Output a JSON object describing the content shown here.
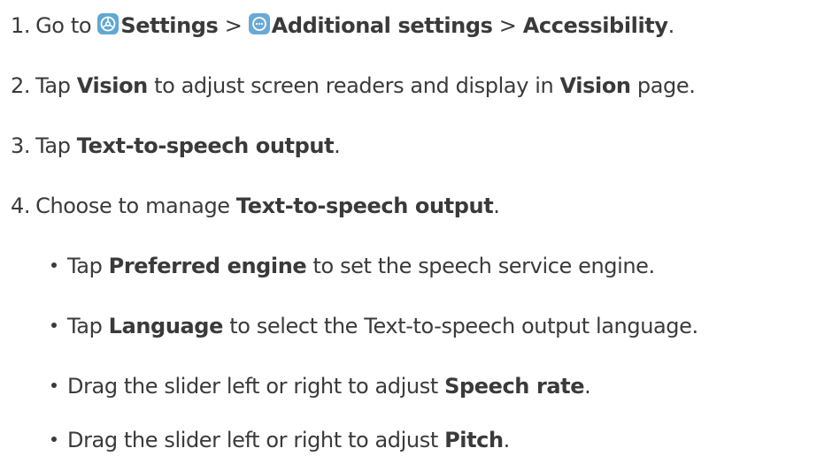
{
  "steps": [
    {
      "number": "1.",
      "go_to": "Go to",
      "settings": "Settings",
      "sep1": ">",
      "additional": "Additional settings",
      "sep2": ">",
      "accessibility": "Accessibility",
      "end": "."
    },
    {
      "number": "2.",
      "pre": "Tap",
      "vision": "Vision",
      "mid": "to adjust screen readers and display in",
      "vision_page": "Vision",
      "post": "page."
    },
    {
      "number": "3.",
      "pre": "Tap",
      "target": "Text-to-speech output",
      "end": "."
    },
    {
      "number": "4.",
      "pre": "Choose to manage",
      "target": "Text-to-speech output",
      "end": "."
    }
  ],
  "bullets": [
    {
      "pre": "Tap",
      "target": "Preferred engine",
      "post": "to set the speech service engine."
    },
    {
      "pre": "Tap",
      "target": "Language",
      "post": "to select the Text-to-speech output language."
    },
    {
      "pre": "Drag the slider left or right to adjust",
      "target": "Speech rate",
      "post": "."
    },
    {
      "pre": "Drag the slider left or right to adjust",
      "target": "Pitch",
      "post": "."
    }
  ],
  "icons": {
    "settings": "settings-gear-icon",
    "additional": "more-dots-icon"
  },
  "colors": {
    "text": "#3a3a3a",
    "icon_bg": "#5fa8d3"
  }
}
